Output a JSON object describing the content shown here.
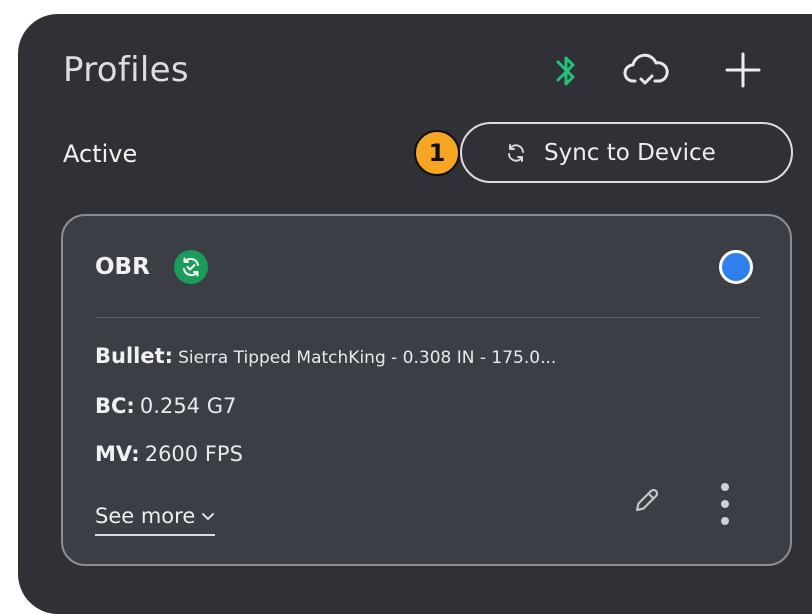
{
  "header": {
    "title": "Profiles",
    "icons": [
      "bluetooth-icon",
      "cloud-sync-icon",
      "add-icon"
    ]
  },
  "section": {
    "label": "Active"
  },
  "step_badge": "1",
  "sync_button": {
    "label": "Sync to Device",
    "icon": "refresh-icon"
  },
  "profile_card": {
    "name": "OBR",
    "synced_icon": "synced-badge-icon",
    "selected": true,
    "bullet_label": "Bullet:",
    "bullet_value": "Sierra Tipped MatchKing - 0.308 IN - 175.0...",
    "bc_label": "BC:",
    "bc_value": "0.254 G7",
    "mv_label": "MV:",
    "mv_value": "2600 FPS",
    "see_more": "See more"
  },
  "colors": {
    "panel_bg": "#2f3136",
    "card_bg": "#3b3e45",
    "bluetooth": "#23c17a",
    "synced": "#1a9c5b",
    "radio": "#2f80ed",
    "badge": "#f6a623"
  }
}
